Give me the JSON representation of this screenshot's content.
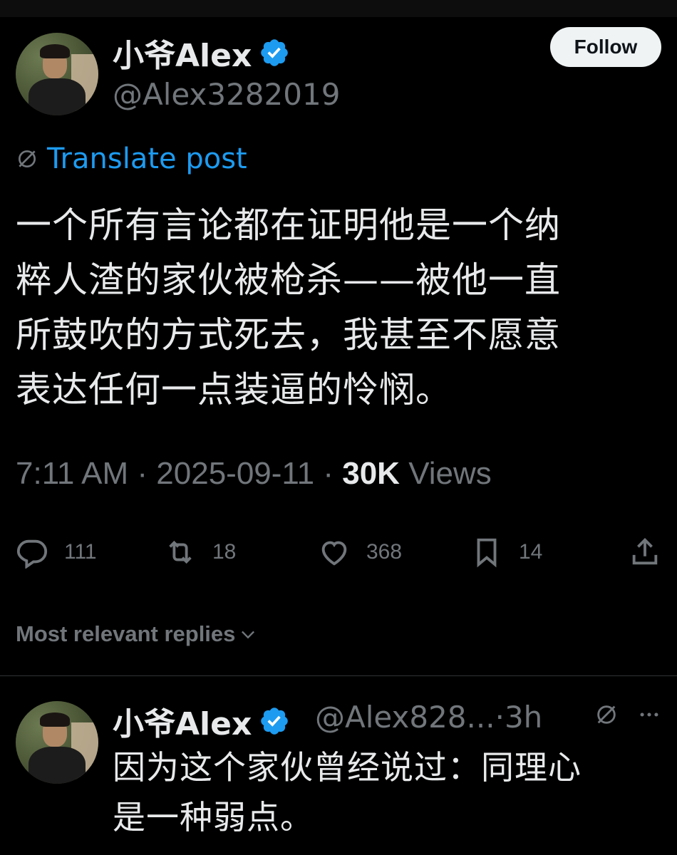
{
  "post": {
    "author": {
      "display_name": "小爷Alex",
      "handle": "@Alex3282019"
    },
    "follow_label": "Follow",
    "translate_label": "Translate post",
    "text_lines": [
      "一个所有言论都在证明他是一个纳",
      "粹人渣的家伙被枪杀——被他一直",
      "所鼓吹的方式死去，我甚至不愿意",
      "表达任何一点装逼的怜悯。"
    ],
    "time": "7:11 AM",
    "date": "2025-09-11",
    "views_count": "30K",
    "views_label": "Views",
    "separator": "·",
    "actions": {
      "replies": "111",
      "reposts": "18",
      "likes": "368",
      "bookmarks": "14"
    }
  },
  "replies_sort_label": "Most relevant replies",
  "reply": {
    "display_name": "小爷Alex",
    "handle": "@Alex828...",
    "age": "3h",
    "text_lines": [
      "因为这个家伙曾经说过：同理心",
      "是一种弱点。"
    ]
  },
  "colors": {
    "background": "#000000",
    "text": "#e7e9ea",
    "muted": "#71767b",
    "accent": "#1d9bf0",
    "follow_bg": "#eff3f4"
  },
  "icons": [
    "verified-badge-icon",
    "translate-globe-icon",
    "reply-icon",
    "repost-icon",
    "like-icon",
    "bookmark-icon",
    "share-icon",
    "chevron-down-icon",
    "more-icon"
  ]
}
